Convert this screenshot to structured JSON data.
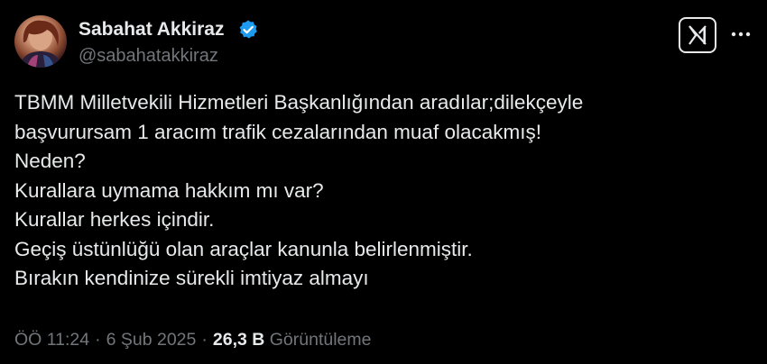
{
  "author": {
    "display_name": "Sabahat Akkiraz",
    "handle": "@sabahatakkiraz"
  },
  "icons": {
    "verified": "verified-badge-icon",
    "x_logo": "x-logo-icon",
    "more": "more-horizontal-icon"
  },
  "colors": {
    "background": "#000000",
    "text": "#e7e9ea",
    "secondary_text": "#71767b",
    "verified_blue": "#1d9bf0"
  },
  "tweet": {
    "lines": [
      "TBMM Milletvekili Hizmetleri Başkanlığından aradılar;dilekçeyle",
      "başvurursam 1 aracım trafik cezalarından muaf olacakmış!",
      "Neden?",
      "Kurallara uymama hakkım mı var?",
      "Kurallar herkes içindir.",
      "Geçiş üstünlüğü olan araçlar kanunla belirlenmiştir.",
      "Bırakın kendinize sürekli imtiyaz almayı"
    ]
  },
  "meta": {
    "time": "ÖÖ 11:24",
    "separator": "·",
    "date": "6 Şub 2025",
    "views_count": "26,3 B",
    "views_label": "Görüntüleme"
  }
}
